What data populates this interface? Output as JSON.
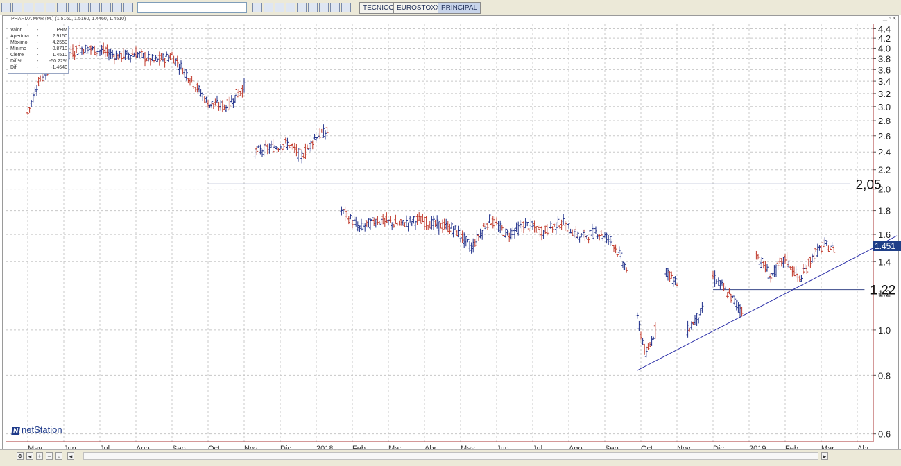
{
  "toolbar": {
    "tabs": [
      "TECNICO",
      "EUROSTOXX",
      "PRINCIPAL"
    ],
    "active_tab": "PRINCIPAL"
  },
  "window": {
    "title": "PHARMA MAR (M.) (1.5160, 1.5160, 1.4460, 1.4510)"
  },
  "info_panel": {
    "rows": [
      {
        "label": "Valor",
        "sep": "-",
        "value": "PHM"
      },
      {
        "label": "Apertura",
        "sep": "-",
        "value": "2.9150"
      },
      {
        "label": "Máximo",
        "sep": "-",
        "value": "4.2550"
      },
      {
        "label": "Mínimo",
        "sep": "-",
        "value": "0.8710"
      },
      {
        "label": "Cierre",
        "sep": "-",
        "value": "1.4510"
      },
      {
        "label": "Dif %",
        "sep": "-",
        "value": "-50.22%"
      },
      {
        "label": "Dif",
        "sep": "-",
        "value": "-1.4640"
      }
    ]
  },
  "branding": {
    "name": "netStation",
    "mark": "N"
  },
  "last_price": "1.451",
  "colors": {
    "up": "#1f2f8a",
    "down": "#c0392b",
    "grid": "#c8c8c8",
    "trend": "#2b2fa8",
    "price_tag": "#1f3f88"
  },
  "chart_data": {
    "type": "ohlc",
    "title": "PHARMA MAR (M.)",
    "y_scale": "log",
    "ylim": [
      0.55,
      4.5
    ],
    "y_ticks": [
      0.6,
      0.8,
      1.0,
      1.2,
      1.4,
      1.6,
      1.8,
      2.0,
      2.2,
      2.4,
      2.6,
      2.8,
      3.0,
      3.2,
      3.4,
      3.6,
      3.8,
      4.0,
      4.2,
      4.4
    ],
    "x_labels": [
      "May",
      "Jun",
      "Jul",
      "Ago",
      "Sep",
      "Oct",
      "Nov",
      "Dic",
      "2018",
      "Feb",
      "Mar",
      "Abr",
      "May",
      "Jun",
      "Jul",
      "Ago",
      "Sep",
      "Oct",
      "Nov",
      "Dic",
      "2019",
      "Feb",
      "Mar",
      "Abr"
    ],
    "grid": true,
    "series": [
      {
        "points": [
          {
            "t": 0,
            "c": 2.9
          },
          {
            "t": 0.3,
            "c": 3.4
          },
          {
            "t": 0.6,
            "c": 3.6
          },
          {
            "t": 1.0,
            "c": 3.85
          },
          {
            "t": 1.5,
            "c": 4.0
          },
          {
            "t": 2.0,
            "c": 3.95
          },
          {
            "t": 2.5,
            "c": 3.85
          },
          {
            "t": 3.0,
            "c": 3.9
          },
          {
            "t": 3.5,
            "c": 3.75
          },
          {
            "t": 4.0,
            "c": 3.85
          },
          {
            "t": 4.5,
            "c": 3.45
          },
          {
            "t": 5.0,
            "c": 3.05
          },
          {
            "t": 5.5,
            "c": 3.0
          },
          {
            "t": 6.0,
            "c": 3.3
          },
          {
            "t": 6.3,
            "c": 2.4
          },
          {
            "t": 6.7,
            "c": 2.45
          },
          {
            "t": 7.2,
            "c": 2.5
          },
          {
            "t": 7.6,
            "c": 2.35
          },
          {
            "t": 8.0,
            "c": 2.6
          },
          {
            "t": 8.3,
            "c": 2.65
          },
          {
            "t": 8.7,
            "c": 1.8
          },
          {
            "t": 9.2,
            "c": 1.65
          },
          {
            "t": 9.7,
            "c": 1.72
          },
          {
            "t": 10.3,
            "c": 1.68
          },
          {
            "t": 10.8,
            "c": 1.72
          },
          {
            "t": 11.3,
            "c": 1.68
          },
          {
            "t": 11.8,
            "c": 1.65
          },
          {
            "t": 12.3,
            "c": 1.5
          },
          {
            "t": 12.8,
            "c": 1.72
          },
          {
            "t": 13.3,
            "c": 1.6
          },
          {
            "t": 13.8,
            "c": 1.68
          },
          {
            "t": 14.3,
            "c": 1.62
          },
          {
            "t": 14.8,
            "c": 1.7
          },
          {
            "t": 15.3,
            "c": 1.58
          },
          {
            "t": 15.8,
            "c": 1.62
          },
          {
            "t": 16.2,
            "c": 1.55
          },
          {
            "t": 16.6,
            "c": 1.35
          },
          {
            "t": 16.9,
            "c": 1.05
          },
          {
            "t": 17.15,
            "c": 0.88
          },
          {
            "t": 17.4,
            "c": 1.0
          },
          {
            "t": 17.7,
            "c": 1.35
          },
          {
            "t": 18.0,
            "c": 1.25
          },
          {
            "t": 18.3,
            "c": 1.0
          },
          {
            "t": 18.7,
            "c": 1.1
          },
          {
            "t": 19.0,
            "c": 1.3
          },
          {
            "t": 19.4,
            "c": 1.2
          },
          {
            "t": 19.8,
            "c": 1.1
          },
          {
            "t": 20.2,
            "c": 1.45
          },
          {
            "t": 20.6,
            "c": 1.3
          },
          {
            "t": 21.0,
            "c": 1.42
          },
          {
            "t": 21.4,
            "c": 1.28
          },
          {
            "t": 21.8,
            "c": 1.45
          },
          {
            "t": 22.1,
            "c": 1.52
          },
          {
            "t": 22.4,
            "c": 1.48
          }
        ]
      }
    ],
    "annotations": [
      {
        "type": "hline",
        "value": 2.05,
        "label": "2,05",
        "t_from": 5.0,
        "t_to": 22.8
      },
      {
        "type": "hline",
        "value": 1.22,
        "label": "1,22",
        "t_from": 19.0,
        "t_to": 23.2
      },
      {
        "type": "trendline",
        "from": {
          "t": 16.9,
          "v": 0.82
        },
        "to": {
          "t": 24.1,
          "v": 1.59
        }
      }
    ]
  }
}
